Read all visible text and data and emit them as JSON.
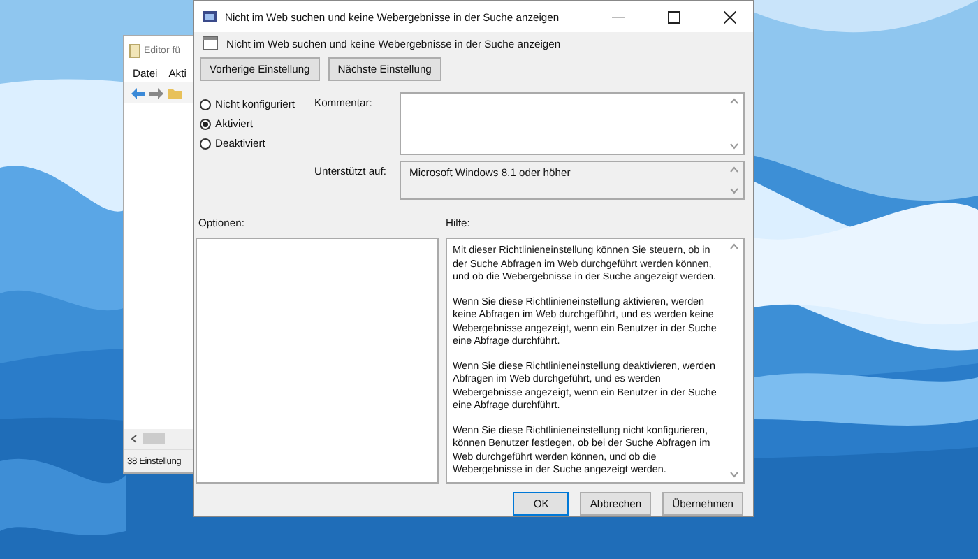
{
  "background_window": {
    "title": "Editor fü",
    "menu": [
      "Datei",
      "Akti"
    ],
    "status_bar": "38 Einstellung"
  },
  "dialog": {
    "title": "Nicht im Web suchen und keine Webergebnisse in der Suche anzeigen",
    "heading": "Nicht im Web suchen und keine Webergebnisse in der Suche anzeigen",
    "nav_buttons": [
      "Vorherige Einstellung",
      "Nächste Einstellung"
    ],
    "states": [
      {
        "label": "Nicht konfiguriert",
        "selected": false
      },
      {
        "label": "Aktiviert",
        "selected": true
      },
      {
        "label": "Deaktiviert",
        "selected": false
      }
    ],
    "comment": {
      "label": "Kommentar:"
    },
    "supported": {
      "label": "Unterstützt auf:",
      "value": "Microsoft Windows 8.1 oder höher"
    },
    "options_label": "Optionen:",
    "help_label": "Hilfe:",
    "help_paragraphs": [
      "Mit dieser Richtlinieneinstellung können Sie steuern, ob in der Suche Abfragen im Web durchgeführt werden können, und ob die Webergebnisse in der Suche angezeigt werden.",
      "Wenn Sie diese Richtlinieneinstellung aktivieren, werden keine Abfragen im Web durchgeführt, und es werden keine Webergebnisse angezeigt, wenn ein Benutzer in der Suche eine Abfrage durchführt.",
      "Wenn Sie diese Richtlinieneinstellung deaktivieren, werden Abfragen im Web durchgeführt, und es werden Webergebnisse angezeigt, wenn ein Benutzer in der Suche eine Abfrage durchführt.",
      "Wenn Sie diese Richtlinieneinstellung nicht konfigurieren, können Benutzer festlegen, ob bei der Suche Abfragen im Web durchgeführt werden können, und ob die Webergebnisse in der Suche angezeigt werden."
    ],
    "buttons": [
      {
        "label": "OK",
        "default": true
      },
      {
        "label": "Abbrechen",
        "default": false
      },
      {
        "label": "Übernehmen",
        "default": false
      }
    ]
  }
}
